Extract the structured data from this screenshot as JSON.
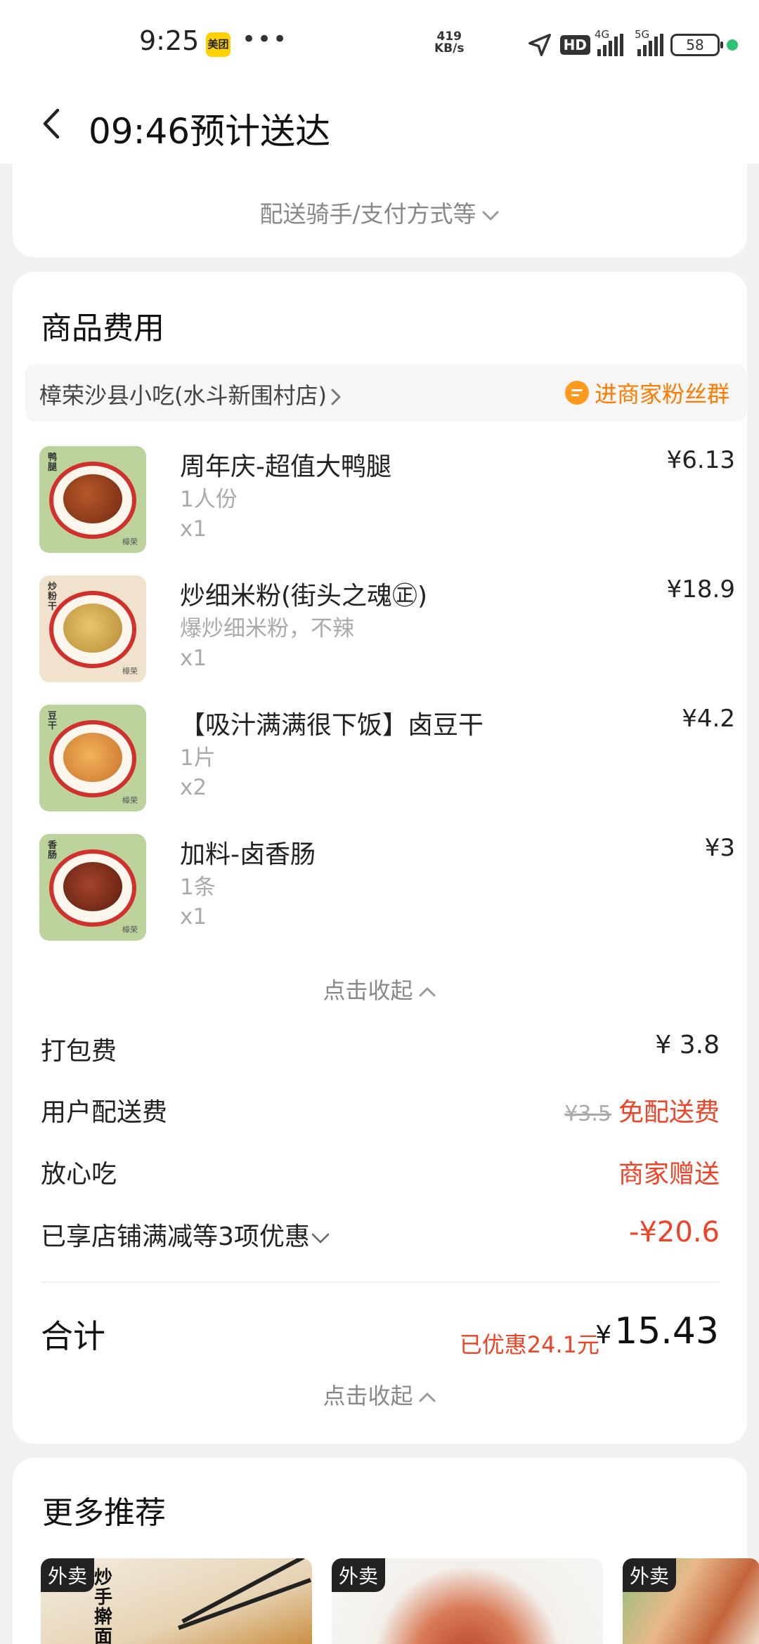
{
  "status_bar": {
    "time": "9:25",
    "app_badge": "美团",
    "speed_value": "419",
    "speed_unit": "KB/s",
    "hd_label": "HD",
    "net1": "4G",
    "net2": "5G",
    "battery": "58"
  },
  "header": {
    "title": "09:46预计送达"
  },
  "delivery_card": {
    "more_info": "配送骑手/支付方式等"
  },
  "fees_card": {
    "title": "商品费用",
    "shop_name": "樟荣沙县小吃(水斗新围村店)",
    "fan_group": "进商家粉丝群",
    "items": [
      {
        "name": "周年庆-超值大鸭腿",
        "spec": "1人份",
        "qty": "x1",
        "price": "¥6.13",
        "tag": "鸭腿",
        "brand": "樟荣"
      },
      {
        "name": "炒细米粉(街头之魂㊣)",
        "spec": "爆炒细米粉，不辣",
        "qty": "x1",
        "price": "¥18.9",
        "tag": "炒粉干",
        "brand": "樟荣"
      },
      {
        "name": "【吸汁满满很下饭】卤豆干",
        "spec": "1片",
        "qty": "x2",
        "price": "¥4.2",
        "tag": "豆干",
        "brand": "樟荣"
      },
      {
        "name": "加料-卤香肠",
        "spec": "1条",
        "qty": "x1",
        "price": "¥3",
        "tag": "香肠",
        "brand": "樟荣"
      }
    ],
    "collapse_label": "点击收起",
    "packing_fee": {
      "label": "打包费",
      "value": "¥ 3.8"
    },
    "delivery_fee": {
      "label": "用户配送费",
      "original": "¥3.5",
      "value": "免配送费"
    },
    "assurance": {
      "label": "放心吃",
      "value": "商家赠送"
    },
    "discounts": {
      "label": "已享店铺满减等3项优惠",
      "value": "-¥20.6"
    },
    "total": {
      "label": "合计",
      "saved": "已优惠24.1元",
      "currency": "¥",
      "amount": "15.43"
    },
    "collapse_label_2": "点击收起"
  },
  "recommend": {
    "title": "更多推荐",
    "cards": [
      {
        "badge": "外卖",
        "sign": "炒手擀面"
      },
      {
        "badge": "外卖"
      },
      {
        "badge": "外卖"
      }
    ]
  },
  "colors": {
    "accent_red": "#ef4327",
    "accent_orange": "#ff7a00",
    "status_green": "#2ec275"
  }
}
